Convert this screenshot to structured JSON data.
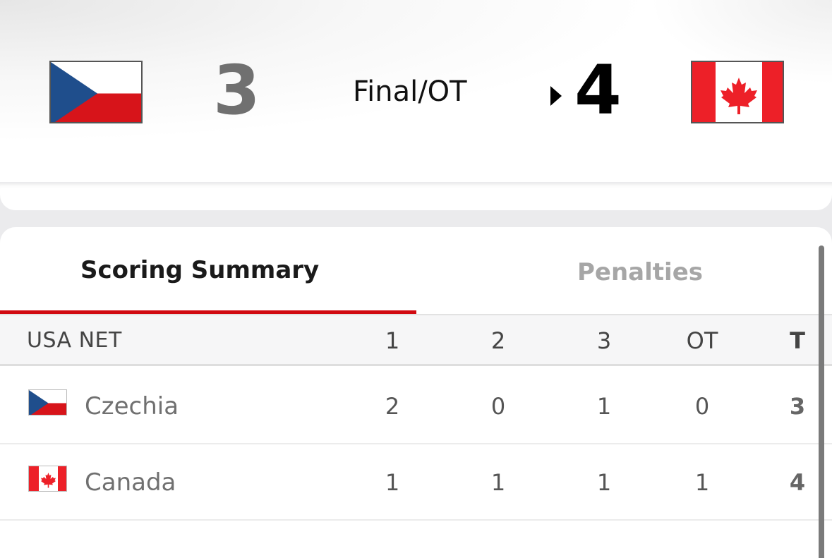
{
  "game": {
    "away": {
      "name": "Czechia",
      "score": "3",
      "flag": "czech-flag"
    },
    "home": {
      "name": "Canada",
      "score": "4",
      "flag": "canada-flag"
    },
    "status": "Final/OT",
    "winner": "home"
  },
  "tabs": [
    {
      "label": "Scoring Summary",
      "active": true
    },
    {
      "label": "Penalties",
      "active": false
    }
  ],
  "table": {
    "network": "USA NET",
    "columns": [
      "1",
      "2",
      "3",
      "OT",
      "T"
    ],
    "rows": [
      {
        "team": "Czechia",
        "periods": [
          "2",
          "0",
          "1",
          "0"
        ],
        "total": "3"
      },
      {
        "team": "Canada",
        "periods": [
          "1",
          "1",
          "1",
          "1"
        ],
        "total": "4"
      }
    ]
  },
  "colors": {
    "accent": "#d10a11",
    "czech_blue": "#1f4e8c",
    "czech_red": "#d7141a",
    "canada_red": "#ed2028"
  }
}
